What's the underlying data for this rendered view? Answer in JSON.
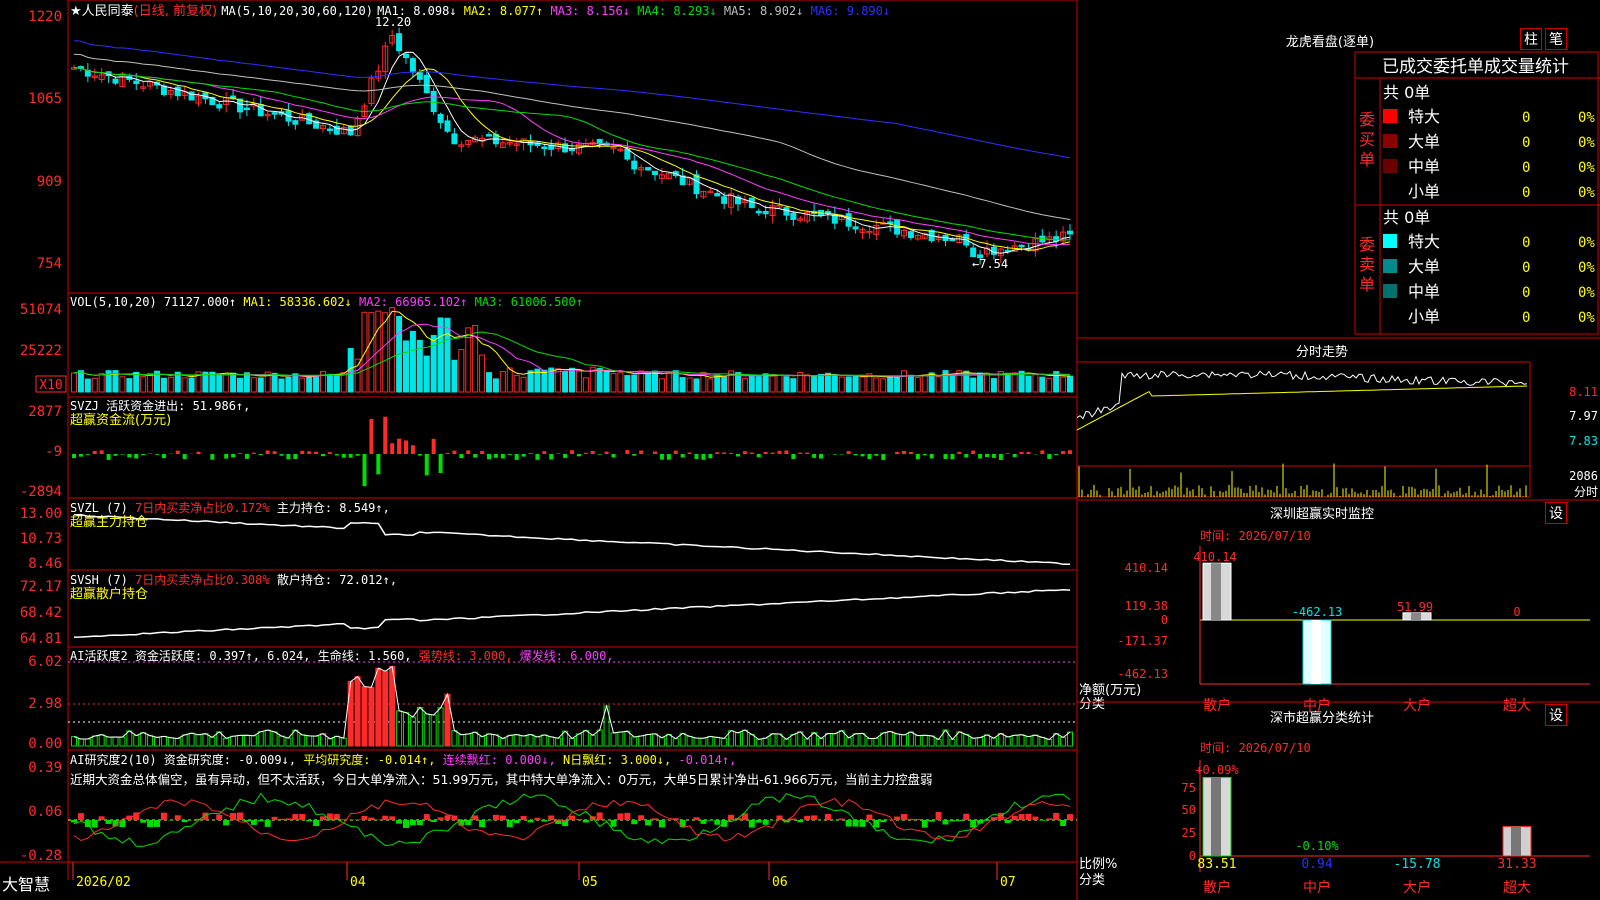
{
  "colors": {
    "up": "#ff2a2a",
    "down": "#00e5e5",
    "grid": "#a00000",
    "axis": "#d00000",
    "yellow": "#ffff00",
    "magenta": "#ff3cff",
    "green": "#00dd00",
    "blue": "#2f2fff",
    "white": "#ffffff",
    "gray": "#c0c0c0"
  },
  "header": {
    "star": "★",
    "stock_name": "人民同泰",
    "period": "(日线, 前复权)",
    "ma_label": "MA(5,10,20,30,60,120)",
    "ma_values": [
      {
        "text": "MA1: 8.098↓",
        "color": "#ffffff"
      },
      {
        "text": "MA2: 8.077↑",
        "color": "#ffff00"
      },
      {
        "text": "MA3: 8.156↓",
        "color": "#ff3cff"
      },
      {
        "text": "MA4: 8.293↓",
        "color": "#00dd00"
      },
      {
        "text": "MA5: 8.902↓",
        "color": "#c0c0c0"
      },
      {
        "text": "MA6: 9.890↓",
        "color": "#2f2fff"
      }
    ],
    "high_mark": "12.20",
    "low_mark": "←7.54"
  },
  "price_axis": [
    "1220",
    "1065",
    "909",
    "754"
  ],
  "vol": {
    "label": "VOL(5,10,20)",
    "value": "71127.000↑",
    "ma1": "MA1: 58336.602↓",
    "ma2": "MA2: 66965.102↑",
    "ma3": "MA3: 61006.500↑",
    "axis": [
      "51074",
      "25222"
    ],
    "unit": "X10"
  },
  "svzj": {
    "label": "SVZJ  活跃资金进出: 51.986↑,",
    "sub": "超赢资金流(万元)",
    "axis": [
      "2877",
      "-9",
      "-2894"
    ]
  },
  "svzl": {
    "label": "SVZL (7)",
    "ratio": "7日内买卖净占比0.172%",
    "hold": "主力持仓: 8.549↑,",
    "sub": "超赢主力持仓",
    "axis": [
      "13.00",
      "10.73",
      "8.46"
    ]
  },
  "svsh": {
    "label": "SVSH (7)",
    "ratio": "7日内买卖净占比0.308%",
    "hold": "散户持仓: 72.012↑,",
    "sub": "超赢散户持仓",
    "axis": [
      "72.17",
      "68.42",
      "64.81"
    ]
  },
  "ai_active": {
    "label": "AI活跃度2 资金活跃度: 0.397↑, 6.024, 生命线: 1.560,",
    "strong": "强势线: 3.000,",
    "burst": "爆发线: 6.000,",
    "axis": [
      "6.02",
      "2.98",
      "0.00"
    ]
  },
  "ai_research": {
    "label": "AI研究度2(10) 资金研究度: -0.009↓,",
    "avg": "平均研究度: -0.014↑,",
    "red": "连续飘红: 0.000↓,",
    "nred": "N日飘红: 3.000↓,",
    "last": "-0.014↑,",
    "comment": "近期大资金总体偏空，虽有异动，但不太活跃，今日大单净流入：51.99万元，其中特大单净流入：0万元，大单5日累计净出-61.966万元，当前主力控盘弱",
    "axis": [
      "0.39",
      "0.06",
      "-0.28"
    ]
  },
  "xaxis": {
    "brand": "大智慧",
    "labels": [
      "2026/02",
      "04",
      "05",
      "06",
      "07"
    ]
  },
  "right": {
    "lhb_title": "龙虎看盘(逐单)",
    "btn1": "柱",
    "btn2": "笔",
    "stats_title": "已成交委托单成交量统计",
    "buy_group": "委买单",
    "sell_group": "委卖单",
    "buy_total": "共 0单",
    "sell_total": "共 0单",
    "buy_rows": [
      {
        "name": "特大",
        "count": "0",
        "pct": "0%",
        "color": "#ff0000"
      },
      {
        "name": "大单",
        "count": "0",
        "pct": "0%",
        "color": "#8a0000"
      },
      {
        "name": "中单",
        "count": "0",
        "pct": "0%",
        "color": "#6a0000"
      },
      {
        "name": "小单",
        "count": "0",
        "pct": "0%",
        "color": "#000000"
      }
    ],
    "sell_rows": [
      {
        "name": "特大",
        "count": "0",
        "pct": "0%",
        "color": "#00ffff"
      },
      {
        "name": "大单",
        "count": "0",
        "pct": "0%",
        "color": "#008b8b"
      },
      {
        "name": "中单",
        "count": "0",
        "pct": "0%",
        "color": "#007070"
      },
      {
        "name": "小单",
        "count": "0",
        "pct": "0%",
        "color": "#000000"
      }
    ],
    "intraday_title": "分时走势",
    "intraday_axis": [
      "8.11",
      "7.97",
      "7.83",
      "2086"
    ],
    "intraday_unit": "分时",
    "sz_title": "深圳超赢实时监控",
    "set1": "设",
    "sz_time": "时间: 2026/07/10",
    "sz_axis": [
      "410.14",
      "119.38",
      "0",
      "-171.37",
      "-462.13"
    ],
    "sz_values": [
      {
        "label": "散户",
        "value": "410.14"
      },
      {
        "label": "中户",
        "value": "-462.13"
      },
      {
        "label": "大户",
        "value": "51.99"
      },
      {
        "label": "超大",
        "value": "0"
      }
    ],
    "sz_unit": "净额(万元)",
    "sz_kind": "分类",
    "sm_title": "深市超赢分类统计",
    "set2": "设",
    "sm_time": "时间: 2026/07/10",
    "sm_axis": [
      "75",
      "50",
      "25",
      "0"
    ],
    "sm_top": [
      {
        "label": "散户",
        "text": "+0.09%"
      },
      {
        "label": "中户",
        "text": "-0.10%"
      }
    ],
    "sm_values": [
      {
        "label": "散户",
        "value": "83.51"
      },
      {
        "label": "中户",
        "value": "0.94"
      },
      {
        "label": "大户",
        "value": "-15.78"
      },
      {
        "label": "超大",
        "value": "31.33"
      }
    ],
    "sm_unit": "比例%",
    "sm_kind": "分类"
  }
}
